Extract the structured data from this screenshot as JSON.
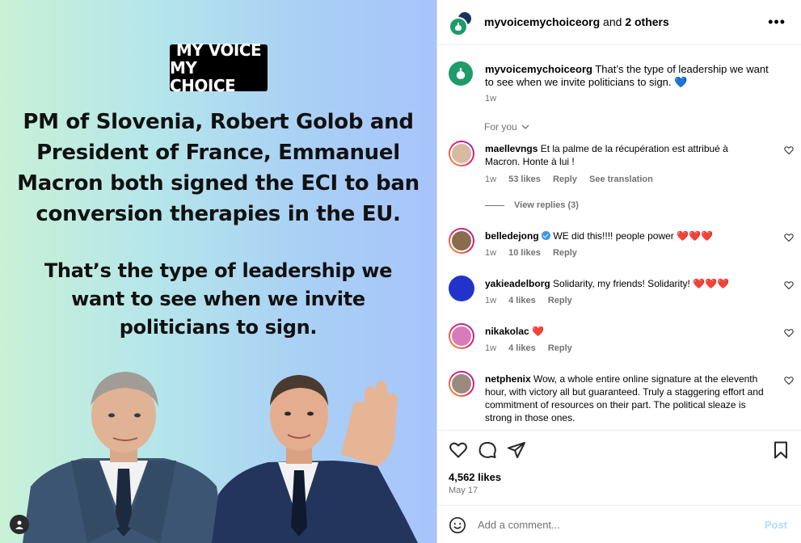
{
  "post": {
    "logo_line1": "MY VOICE",
    "logo_line2": "MY CHOICE",
    "headline": "PM of Slovenia, Robert Golob and President of France, Emmanuel Macron both signed the ECI to ban conversion therapies in the EU.",
    "subline": "That’s the type of leadership we want to see when we invite politicians to sign."
  },
  "header": {
    "username": "myvoicemychoiceorg",
    "and": " and ",
    "others": "2 others",
    "more_icon": "more-horizontal-icon"
  },
  "caption": {
    "username": "myvoicemychoiceorg",
    "text": " That’s the type of leadership we want to see when we invite politicians to sign. ",
    "emoji": "💙",
    "time": "1w"
  },
  "for_you": "For you",
  "comments": [
    {
      "username": "maellevngs",
      "text": " Et la palme de la récupération est attribué à Macron. Honte à lui !",
      "emoji": "",
      "time": "1w",
      "likes": "53 likes",
      "reply": "Reply",
      "translation": "See translation",
      "view_replies": "View replies (3)",
      "avatar_color": "#d9b9a3"
    },
    {
      "username": "belledejong",
      "text": " WE did this!!!! people power ",
      "emoji": "❤️❤️❤️",
      "time": "1w",
      "likes": "10 likes",
      "reply": "Reply",
      "avatar_color": "#8a6b4e"
    },
    {
      "username": "yakieadelborg",
      "text": " Solidarity, my friends! Solidarity! ",
      "emoji": "❤️❤️❤️",
      "time": "1w",
      "likes": "4 likes",
      "reply": "Reply",
      "avatar_color": "#2233cc"
    },
    {
      "username": "nikakolac",
      "text": " ",
      "emoji": "❤️",
      "time": "1w",
      "likes": "4 likes",
      "reply": "Reply",
      "avatar_color": "#d97bb8"
    },
    {
      "username": "netphenix",
      "text": " Wow, a whole entire online signature at the eleventh hour, with victory all but guaranteed. Truly a staggering effort and commitment of resources on their part. The political sleaze is strong in those ones.",
      "emoji": "",
      "time": "",
      "avatar_color": "#9a8a80"
    }
  ],
  "actions": {
    "likes": "4,562 likes",
    "date": "May 17"
  },
  "add_comment": {
    "placeholder": "Add a comment...",
    "post_label": "Post"
  }
}
